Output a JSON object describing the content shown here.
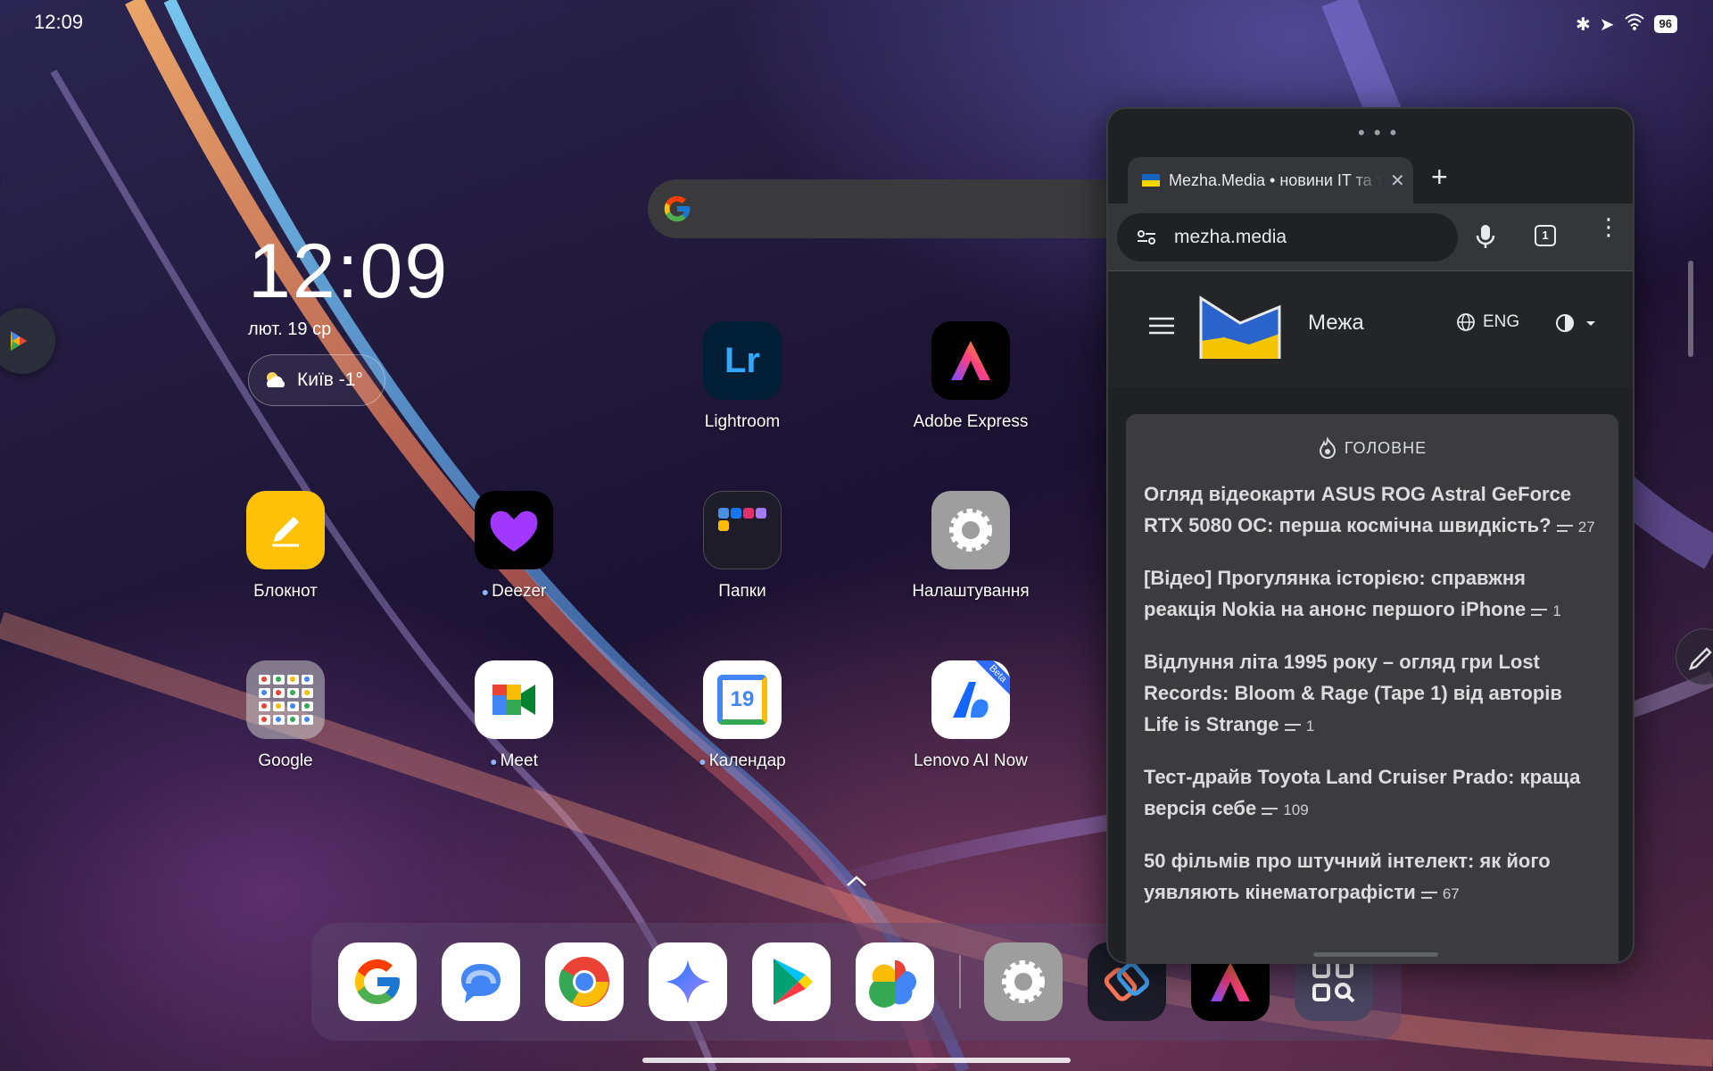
{
  "status_bar": {
    "time": "12:09",
    "battery": "96"
  },
  "clock_widget": {
    "time": "12:09",
    "date": "лют. 19 ср",
    "weather": "Київ -1°"
  },
  "home_apps": [
    {
      "name": "Lightroom"
    },
    {
      "name": "Adobe Express"
    },
    {
      "name": "Блокнот"
    },
    {
      "name": "Deezer"
    },
    {
      "name": "Папки"
    },
    {
      "name": "Налаштування"
    },
    {
      "name": "Google"
    },
    {
      "name": "Meet"
    },
    {
      "name": "Календар"
    },
    {
      "name": "Lenovo AI Now"
    }
  ],
  "icon_text": {
    "lightroom": "Lr",
    "calendar_day": "19",
    "beta_ribbon": "Beta"
  },
  "browser": {
    "tab_title": "Mezha.Media • новини IT та технології",
    "url": "mezha.media",
    "tab_count": "1",
    "site_name": "Межа",
    "language": "ENG",
    "section_title": "ГОЛОВНЕ",
    "articles": [
      {
        "title": "Огляд відеокарти ASUS ROG Astral GeForce RTX 5080 OC: перша космічна швидкість?",
        "comments": "27"
      },
      {
        "title": "[Відео] Прогулянка історією: справжня реакція Nokia на анонс першого iPhone",
        "comments": "1"
      },
      {
        "title": "Відлуння літа 1995 року – огляд гри Lost Records: Bloom & Rage (Tape 1) від авторів Life is Strange",
        "comments": "1"
      },
      {
        "title": "Тест-драйв Toyota Land Cruiser Prado: краща версія себе",
        "comments": "109"
      },
      {
        "title": "50 фільмів про штучний інтелект: як його уявляють кінематографісти",
        "comments": "67"
      }
    ]
  },
  "dock_apps": [
    "google-icon",
    "messages-icon",
    "chrome-icon",
    "gemini-icon",
    "play-store-icon",
    "photos-icon",
    "settings-icon",
    "shortcuts-icon",
    "adobe-express-icon",
    "scanner-icon"
  ],
  "colors": {
    "accent_blue": "#8ab4ff",
    "browser_bg": "#202124",
    "card_bg": "#3c3c3e"
  }
}
